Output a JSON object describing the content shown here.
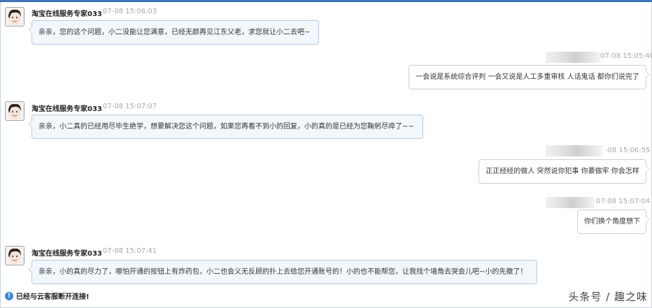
{
  "chat": {
    "messages": [
      {
        "direction": "in",
        "sender": "淘宝在线服务专家033",
        "time": "07-08 15:06:03",
        "text": "亲亲，您的这个问题，小二没能让您满意，已经无颜再见江东父老，求您就让小二去吧~"
      },
      {
        "direction": "out",
        "sender": "",
        "time": "07-08 15:05:40",
        "text": "一会说是系统综合评判 一会又说是人工多重审核 人话鬼话 都你们说完了"
      },
      {
        "direction": "in",
        "sender": "淘宝在线服务专家033",
        "time": "07-08 15:07:07",
        "text": "亲亲，小二真的已经用尽毕生绝学，想要解决您这个问题，如果您再看不到小的回复，小的真的是已经为您鞠躬尽瘁了~~"
      },
      {
        "direction": "out",
        "sender": "",
        "time": "-08 15:06:55",
        "text": "正正经经的做人 突然说你犯事 你要做牢 你会怎样"
      },
      {
        "direction": "out",
        "sender": "",
        "time": "07-08 15:07:04",
        "text": "你们换个角度想下"
      },
      {
        "direction": "in",
        "sender": "淘宝在线服务专家033",
        "time": "07-08 15:07:41",
        "text": "亲亲，小的真的尽力了，哪怕开通的按钮上有炸药包，小二也会义无反顾的扑上去给您开通账号的！小的也不能帮您，让我找个墙角去哭会儿吧~小的先撤了！"
      }
    ]
  },
  "status": {
    "icon": "info-icon",
    "text": "已经与云客服断开连接!"
  },
  "watermark": {
    "text": "头条号 / 趣之味"
  },
  "colors": {
    "accent": "#3e74b8",
    "incoming_bubble_bg": "#f2f7fc",
    "incoming_bubble_border": "#b4cbe2",
    "outgoing_bubble_border": "#cfcfcf",
    "timestamp": "#a8a8a8"
  }
}
